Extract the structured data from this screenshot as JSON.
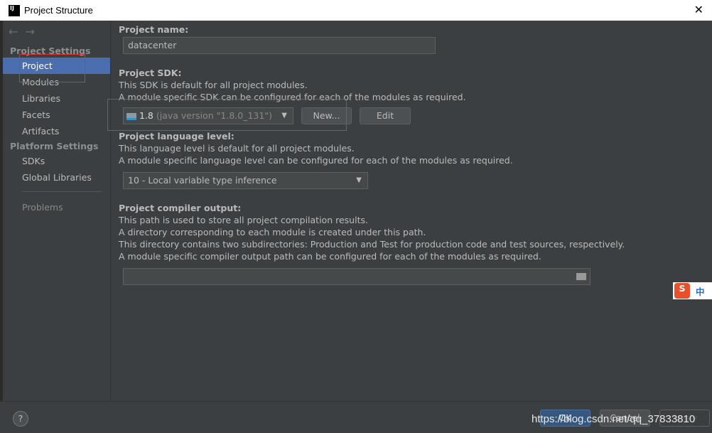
{
  "window": {
    "title": "Project Structure",
    "logo": "IJ",
    "close": "✕"
  },
  "sidebar": {
    "back": "←",
    "forward": "→",
    "project_settings": "Project Settings",
    "platform_settings": "Platform Settings",
    "items": [
      "Project",
      "Modules",
      "Libraries",
      "Facets",
      "Artifacts"
    ],
    "platform_items": [
      "SDKs",
      "Global Libraries"
    ],
    "problems": "Problems",
    "selected": "Project"
  },
  "main": {
    "name_label": "Project name:",
    "name_value": "datacenter",
    "sdk_label": "Project SDK:",
    "sdk_desc1": "This SDK is default for all project modules.",
    "sdk_desc2": "A module specific SDK can be configured for each of the modules as required.",
    "sdk_version": "1.8",
    "sdk_detail": "(java version \"1.8.0_131\")",
    "new_button": "New...",
    "edit_button": "Edit",
    "lang_label": "Project language level:",
    "lang_desc1": "This language level is default for all project modules.",
    "lang_desc2": "A module specific language level can be configured for each of the modules as required.",
    "lang_value": "10 - Local variable type inference",
    "out_label": "Project compiler output:",
    "out_desc1": "This path is used to store all project compilation results.",
    "out_desc2": "A directory corresponding to each module is created under this path.",
    "out_desc3": "This directory contains two subdirectories: Production and Test for production code and test sources, respectively.",
    "out_desc4": "A module specific compiler output path can be configured for each of the modules as required.",
    "out_value": ""
  },
  "footer": {
    "help": "?",
    "ok": "OK",
    "cancel": "Cancel",
    "apply": "Apply",
    "watermark": "https://blog.csdn.net/qq_37833810"
  },
  "ime": {
    "logo": "S",
    "mode": "中"
  },
  "colors": {
    "selection": "#4b6eaf",
    "annotation": "#e03030"
  }
}
